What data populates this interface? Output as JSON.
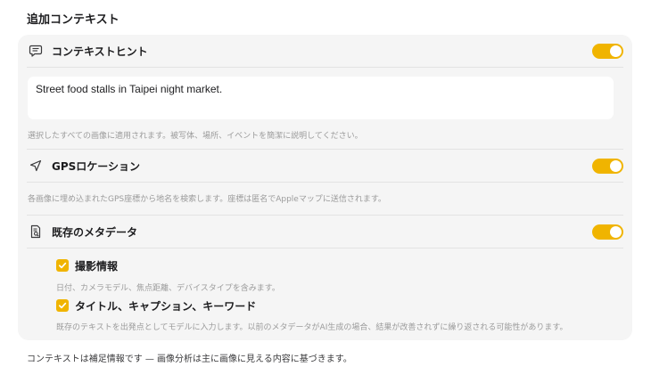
{
  "section": {
    "title": "追加コンテキスト"
  },
  "context_hint": {
    "label": "コンテキストヒント",
    "enabled": true,
    "icon": "message-icon",
    "value": "Street food stalls in Taipei night market.",
    "help": "選択したすべての画像に適用されます。被写体、場所、イベントを簡潔に説明してください。"
  },
  "gps": {
    "label": "GPSロケーション",
    "enabled": true,
    "icon": "location-arrow-icon",
    "help": "各画像に埋め込まれたGPS座標から地名を検索します。座標は匿名でAppleマップに送信されます。"
  },
  "metadata": {
    "label": "既存のメタデータ",
    "enabled": true,
    "icon": "document-search-icon",
    "options": [
      {
        "label": "撮影情報",
        "checked": true,
        "help": "日付、カメラモデル、焦点距離、デバイスタイプを含みます。"
      },
      {
        "label": "タイトル、キャプション、キーワード",
        "checked": true,
        "help": "既存のテキストを出発点としてモデルに入力します。以前のメタデータがAI生成の場合、結果が改善されずに繰り返される可能性があります。"
      }
    ]
  },
  "footer": {
    "note": "コンテキストは補足情報です — 画像分析は主に画像に見える内容に基づきます。"
  },
  "colors": {
    "accent": "#f0b400",
    "card_background": "#f5f5f5"
  }
}
